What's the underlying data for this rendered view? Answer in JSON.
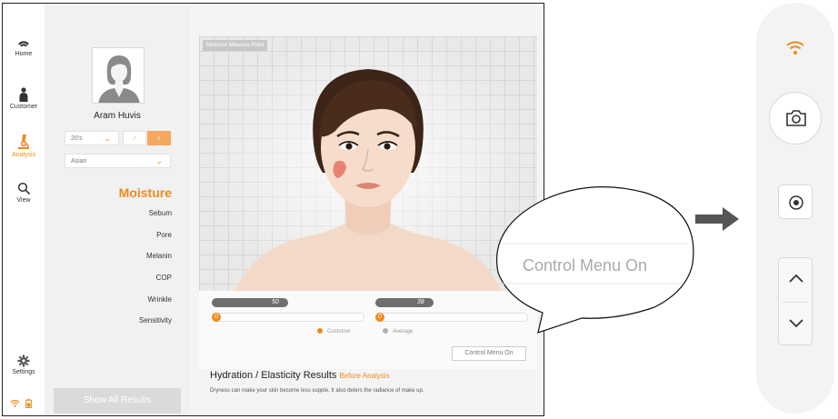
{
  "nav": {
    "items": [
      {
        "label": "Home",
        "icon": "home-icon"
      },
      {
        "label": "Customer",
        "icon": "customer-icon"
      },
      {
        "label": "Analysis",
        "icon": "microscope-icon",
        "active": true
      },
      {
        "label": "View",
        "icon": "search-icon"
      }
    ],
    "settings_label": "Settings"
  },
  "profile": {
    "name": "Aram Huvis",
    "age_group": "20's",
    "ethnicity": "Asian",
    "gender_selected": "female"
  },
  "metrics": {
    "items": [
      "Moisture",
      "Sebum",
      "Pore",
      "Melanin",
      "COP",
      "Wrinkle",
      "Sensitivity"
    ],
    "active": "Moisture"
  },
  "show_all_label": "Show All Results",
  "panel": {
    "tag": "Moisture Measure Point"
  },
  "bars": {
    "left_average": 50,
    "right_average": 38,
    "left_customer": "0",
    "right_customer": "0",
    "legend_customer": "Customer",
    "legend_average": "Average"
  },
  "control_menu_label": "Control Menu On",
  "results": {
    "title": "Hydration / Elasticity Results",
    "subtitle": "Before Analysis",
    "description": "Dryness can make your skin become less supple.  It also deters the radiance of make up."
  },
  "callout_text": "Control Menu On",
  "colors": {
    "accent": "#f08a1c",
    "average_bar": "#6e6e6e",
    "customer_dot": "#f08a1c",
    "average_dot": "#b0b0b0"
  },
  "right_controls": {
    "icons": [
      "wifi-icon",
      "camera-icon",
      "record-icon",
      "chevron-up-icon",
      "chevron-down-icon"
    ]
  }
}
